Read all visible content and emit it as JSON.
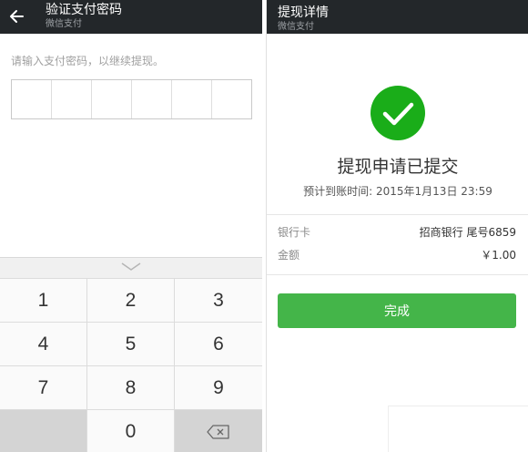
{
  "verify_screen": {
    "title": "验证支付密码",
    "subtitle": "微信支付",
    "prompt": "请输入支付密码，以继续提现。",
    "password_digits_entered": 0,
    "keys": [
      "1",
      "2",
      "3",
      "4",
      "5",
      "6",
      "7",
      "8",
      "9",
      "",
      "0",
      "delete"
    ]
  },
  "detail_screen": {
    "title": "提现详情",
    "subtitle": "微信支付",
    "headline": "提现申请已提交",
    "arrival_text": "预计到账时间: 2015年1月13日 23:59",
    "rows": [
      {
        "label": "银行卡",
        "value": "招商银行 尾号6859"
      },
      {
        "label": "金额",
        "value": "￥1.00"
      }
    ],
    "done_label": "完成"
  },
  "colors": {
    "topbar": "#23272a",
    "success_green": "#1aad19",
    "button_green": "#44b549"
  }
}
